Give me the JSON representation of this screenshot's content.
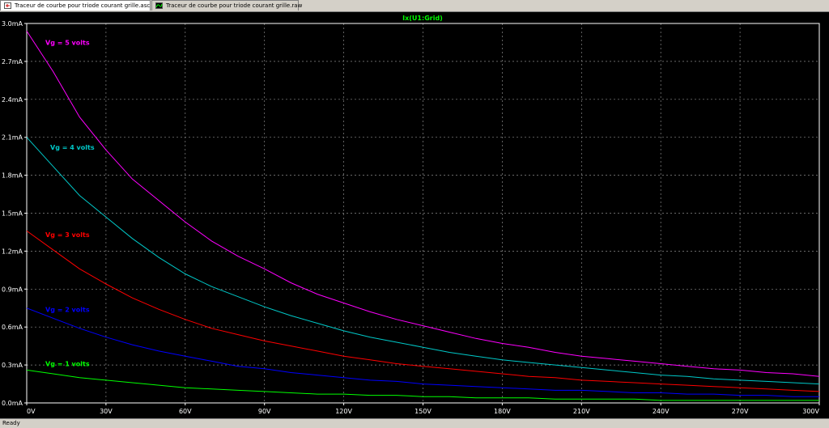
{
  "tabs": [
    {
      "label": "Traceur de courbe pour triode courant grille.asc",
      "active": true,
      "icon": "schematic-icon"
    },
    {
      "label": "Traceur de courbe pour triode courant grille.raw",
      "active": false,
      "icon": "waveform-icon"
    }
  ],
  "status": {
    "text": "Ready"
  },
  "colors": {
    "background": "#000000",
    "grid": "#8a8a8a",
    "axis": "#ffffff",
    "title": "#00ff00"
  },
  "chart_data": {
    "type": "line",
    "title": "Ix(U1:Grid)",
    "xlabel": "",
    "ylabel": "",
    "xlim": [
      0,
      300
    ],
    "ylim": [
      0,
      3.0
    ],
    "grid": true,
    "x_ticks": [
      "0V",
      "30V",
      "60V",
      "90V",
      "120V",
      "150V",
      "180V",
      "210V",
      "240V",
      "270V",
      "300V"
    ],
    "y_ticks": [
      "0.0mA",
      "0.3mA",
      "0.6mA",
      "0.9mA",
      "1.2mA",
      "1.5mA",
      "1.8mA",
      "2.1mA",
      "2.4mA",
      "2.7mA",
      "3.0mA"
    ],
    "x": [
      0,
      10,
      20,
      30,
      40,
      50,
      60,
      70,
      80,
      90,
      100,
      110,
      120,
      130,
      140,
      150,
      160,
      170,
      180,
      190,
      200,
      210,
      220,
      230,
      240,
      250,
      260,
      270,
      280,
      290,
      300
    ],
    "series": [
      {
        "name": "Vg = 5 volts",
        "color": "#ff00ff",
        "values": [
          2.94,
          2.62,
          2.26,
          2.0,
          1.77,
          1.6,
          1.43,
          1.28,
          1.16,
          1.06,
          0.95,
          0.86,
          0.79,
          0.72,
          0.66,
          0.61,
          0.56,
          0.51,
          0.47,
          0.44,
          0.4,
          0.37,
          0.35,
          0.33,
          0.31,
          0.29,
          0.27,
          0.26,
          0.24,
          0.23,
          0.21
        ]
      },
      {
        "name": "Vg = 4 volts",
        "color": "#00c8c8",
        "values": [
          2.1,
          1.87,
          1.64,
          1.47,
          1.3,
          1.15,
          1.02,
          0.92,
          0.84,
          0.76,
          0.69,
          0.63,
          0.57,
          0.52,
          0.48,
          0.44,
          0.4,
          0.37,
          0.34,
          0.32,
          0.3,
          0.28,
          0.26,
          0.24,
          0.22,
          0.21,
          0.19,
          0.18,
          0.17,
          0.16,
          0.15
        ]
      },
      {
        "name": "Vg = 3 volts",
        "color": "#ff0000",
        "values": [
          1.36,
          1.21,
          1.06,
          0.94,
          0.83,
          0.74,
          0.66,
          0.59,
          0.54,
          0.49,
          0.45,
          0.41,
          0.37,
          0.34,
          0.31,
          0.29,
          0.27,
          0.25,
          0.23,
          0.21,
          0.2,
          0.18,
          0.17,
          0.16,
          0.15,
          0.14,
          0.13,
          0.12,
          0.11,
          0.1,
          0.09
        ]
      },
      {
        "name": "Vg = 2 volts",
        "color": "#0000ff",
        "values": [
          0.75,
          0.67,
          0.59,
          0.52,
          0.46,
          0.41,
          0.37,
          0.33,
          0.29,
          0.27,
          0.24,
          0.22,
          0.2,
          0.18,
          0.17,
          0.15,
          0.14,
          0.13,
          0.12,
          0.11,
          0.1,
          0.1,
          0.09,
          0.08,
          0.08,
          0.07,
          0.07,
          0.06,
          0.06,
          0.05,
          0.05
        ]
      },
      {
        "name": "Vg = 1 volts",
        "color": "#00ff00",
        "values": [
          0.26,
          0.23,
          0.2,
          0.18,
          0.16,
          0.14,
          0.12,
          0.11,
          0.1,
          0.09,
          0.08,
          0.07,
          0.07,
          0.06,
          0.06,
          0.05,
          0.05,
          0.04,
          0.04,
          0.04,
          0.03,
          0.03,
          0.03,
          0.03,
          0.02,
          0.02,
          0.02,
          0.02,
          0.02,
          0.02,
          0.02
        ]
      }
    ]
  }
}
